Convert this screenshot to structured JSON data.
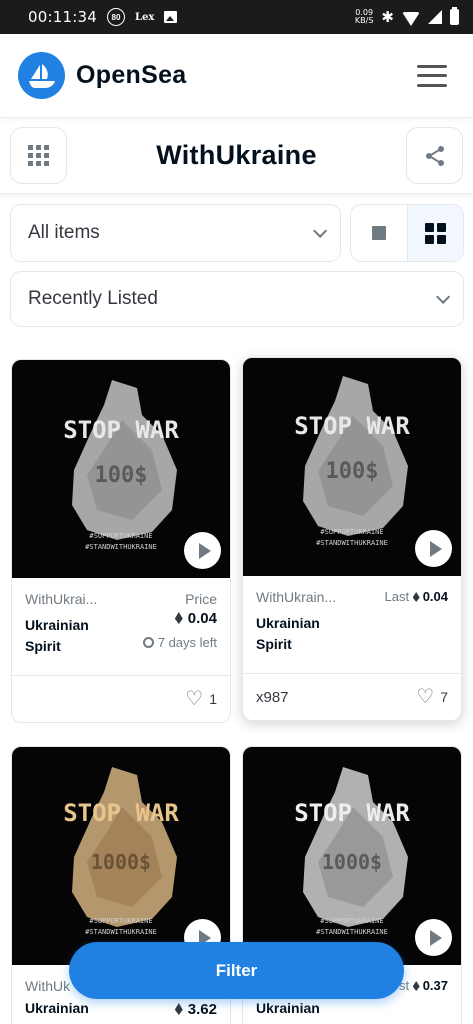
{
  "status_bar": {
    "time": "00:11:34",
    "badge": "80",
    "app_label": "Lex",
    "net_speed_top": "0.09",
    "net_speed_bottom": "KB/S"
  },
  "header": {
    "brand": "OpenSea"
  },
  "collection": {
    "title": "WithUkraine"
  },
  "filters": {
    "items_select": "All items",
    "sort_select": "Recently Listed"
  },
  "artwork_text": {
    "line1": "STOP WAR",
    "hashtag1": "#SUPPORTUKRAINE",
    "hashtag2": "#STANDWITHUKRAINE"
  },
  "cards": [
    {
      "collection": "WithUkrai...",
      "name": "Ukrainian Spirit",
      "price_label": "Price",
      "price": "0.04",
      "time_left": "7 days left",
      "edition": "",
      "likes": "1",
      "art_value": "100$"
    },
    {
      "collection": "WithUkrain...",
      "name": "Ukrainian Spirit",
      "price_label": "Last",
      "price": "0.04",
      "edition": "x987",
      "likes": "7",
      "art_value": "100$"
    },
    {
      "collection": "WithUk",
      "name": "Ukrainian",
      "price": "3.62",
      "art_value": "1000$"
    },
    {
      "collection": "",
      "name": "Ukrainian",
      "price_label": "st",
      "price": "0.37",
      "art_value": "1000$"
    }
  ],
  "filter_button": {
    "label": "Filter"
  },
  "colors": {
    "accent": "#2081e2",
    "text": "#04111d",
    "muted": "#707a83"
  }
}
